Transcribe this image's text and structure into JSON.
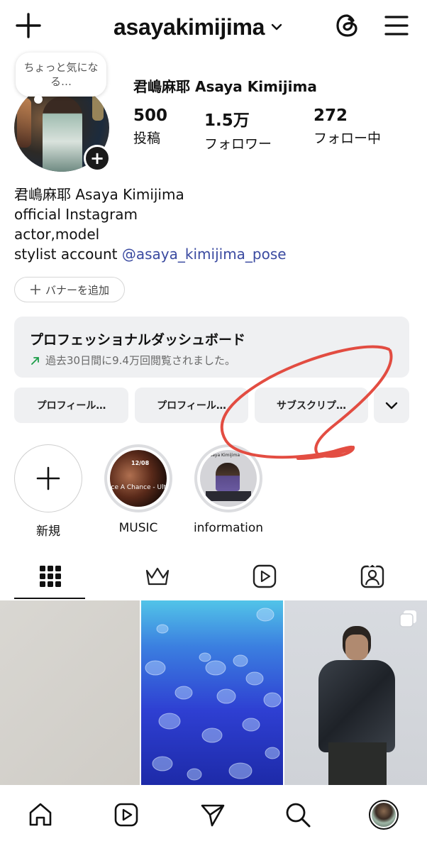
{
  "header": {
    "username": "asayakimijima"
  },
  "profile": {
    "note": "ちょっと気になる…",
    "display_name": "君嶋麻耶 Asaya Kimijima",
    "stats": [
      {
        "value": "500",
        "label": "投稿"
      },
      {
        "value": "1.5万",
        "label": "フォロワー"
      },
      {
        "value": "272",
        "label": "フォロー中"
      }
    ],
    "bio": {
      "line1": "君嶋麻耶 Asaya Kimijima",
      "line2": "official Instagram",
      "line3": "actor,model",
      "line4_prefix": "stylist account ",
      "line4_link": "@asaya_kimijima_pose"
    },
    "banner_button": "バナーを追加"
  },
  "dashboard": {
    "title": "プロフェッショナルダッシュボード",
    "subtitle": "過去30日間に9.4万回閲覧されました。"
  },
  "actions": {
    "chips": [
      "プロフィール…",
      "プロフィール…",
      "サブスクリプ…"
    ]
  },
  "highlights": {
    "new_label": "新規",
    "items": [
      {
        "label": "MUSIC",
        "cover_date": "12/08",
        "cover_text": "ace A Chance - Ulti"
      },
      {
        "label": "information",
        "cover_text": "Asaya Kimijima"
      }
    ]
  },
  "tabs": [
    "grid",
    "subscriptions",
    "reels",
    "tagged"
  ],
  "colors": {
    "link": "#3a4aa0",
    "trend_up": "#1e9e4a",
    "annotation_red": "#e03a2e",
    "card_bg": "#eff0f2"
  }
}
